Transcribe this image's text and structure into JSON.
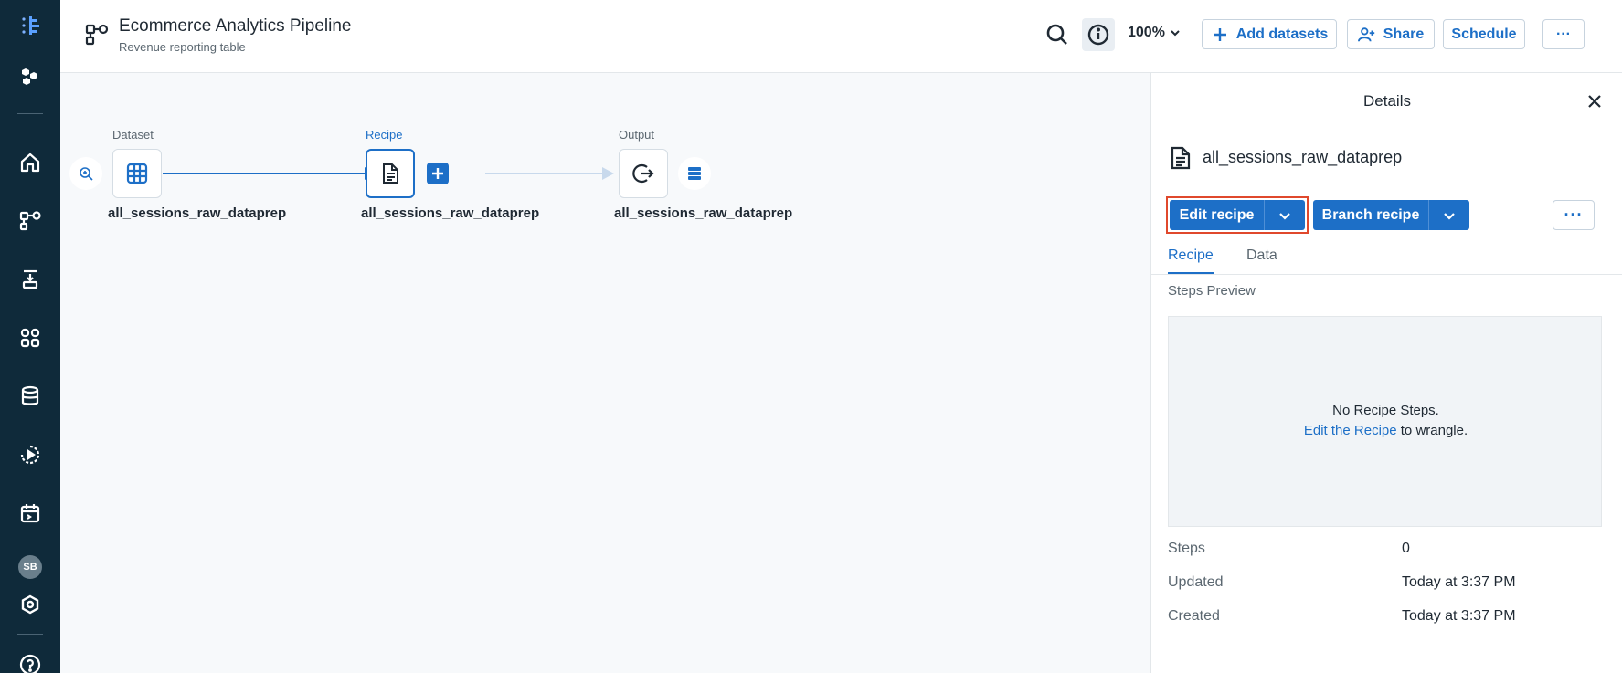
{
  "header": {
    "title": "Ecommerce Analytics Pipeline",
    "subtitle": "Revenue reporting table",
    "zoom": "100%",
    "add_datasets": "Add datasets",
    "share": "Share",
    "schedule": "Schedule",
    "more": "···"
  },
  "leftnav": {
    "avatar": "SB",
    "icons": [
      "logo-icon",
      "hexagons-icon",
      "home-icon",
      "flow-icon",
      "import-icon",
      "apps-icon",
      "database-icon",
      "jobs-icon",
      "calendar-icon",
      "settings-icon",
      "help-icon"
    ]
  },
  "flow": {
    "nodes": [
      {
        "caption": "Dataset",
        "label": "all_sessions_raw_dataprep",
        "icon": "table-icon"
      },
      {
        "caption": "Recipe",
        "label": "all_sessions_raw_dataprep",
        "icon": "document-icon"
      },
      {
        "caption": "Output",
        "label": "all_sessions_raw_dataprep",
        "icon": "output-icon"
      }
    ]
  },
  "panel": {
    "title": "Details",
    "item_name": "all_sessions_raw_dataprep",
    "edit_recipe": "Edit recipe",
    "branch_recipe": "Branch recipe",
    "more": "···",
    "tabs": [
      {
        "label": "Recipe"
      },
      {
        "label": "Data"
      }
    ],
    "steps_preview_label": "Steps Preview",
    "preview_line1": "No Recipe Steps.",
    "preview_link": "Edit the Recipe",
    "preview_suffix": " to wrangle.",
    "meta": [
      {
        "key": "Steps",
        "value": "0"
      },
      {
        "key": "Updated",
        "value": "Today at 3:37 PM"
      },
      {
        "key": "Created",
        "value": "Today at 3:37 PM"
      }
    ]
  },
  "colors": {
    "accent": "#1d6fc7",
    "nav_bg": "#0f2a3a",
    "highlight": "#e0482c"
  }
}
